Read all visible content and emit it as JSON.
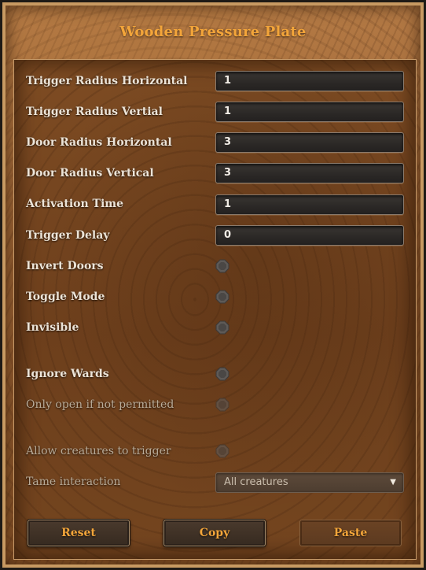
{
  "dialog": {
    "title": "Wooden Pressure Plate"
  },
  "fields": [
    {
      "label": "Trigger Radius Horizontal",
      "value": "1"
    },
    {
      "label": "Trigger Radius Vertial",
      "value": "1"
    },
    {
      "label": "Door Radius Horizontal",
      "value": "3"
    },
    {
      "label": "Door Radius Vertical",
      "value": "3"
    },
    {
      "label": "Activation Time",
      "value": "1"
    },
    {
      "label": "Trigger Delay",
      "value": "0"
    }
  ],
  "toggles": [
    {
      "label": "Invert Doors",
      "enabled": true,
      "checked": false
    },
    {
      "label": "Toggle Mode",
      "enabled": true,
      "checked": false
    },
    {
      "label": "Invisible",
      "enabled": true,
      "checked": false
    },
    {
      "label": "Ignore Wards",
      "enabled": true,
      "checked": false
    },
    {
      "label": "Only open if not permitted",
      "enabled": false,
      "checked": false
    },
    {
      "label": "Allow creatures to trigger",
      "enabled": false,
      "checked": false
    }
  ],
  "tame": {
    "label": "Tame interaction",
    "selected": "All creatures",
    "icon": "chevron-down-icon"
  },
  "buttons": {
    "reset": "Reset",
    "copy": "Copy",
    "paste": "Paste"
  },
  "colors": {
    "title": "#f3a53a",
    "button_text": "#f3a53a",
    "label": "#ece4d8",
    "label_disabled": "#b9ab98"
  }
}
